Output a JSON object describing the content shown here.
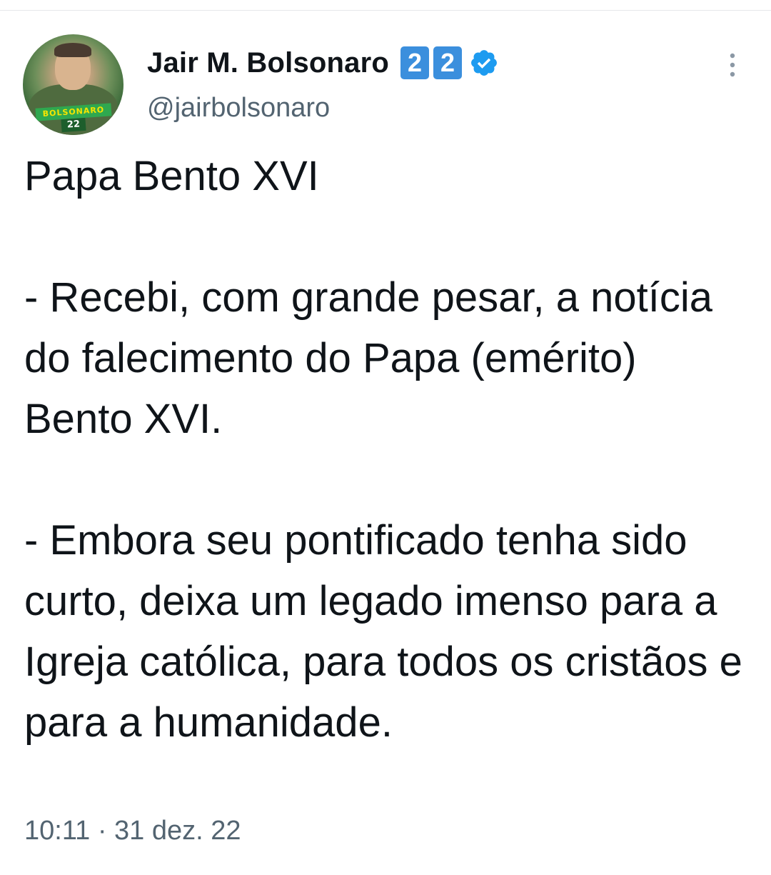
{
  "author": {
    "display_name": "Jair M. Bolsonaro",
    "handle": "@jairbolsonaro",
    "name_badges": [
      "2",
      "2"
    ],
    "avatar_banner": "BOLSONARO",
    "avatar_number": "22"
  },
  "tweet": {
    "text": "Papa Bento XVI\n\n- Recebi, com grande pesar, a notícia do falecimento do Papa (emérito) Bento XVI.\n\n- Embora seu pontificado tenha sido curto, deixa um legado imenso para a Igreja católica, para todos os cristãos e para a humanidade.",
    "timestamp": "10:11 · 31 dez. 22"
  },
  "icons": {
    "verified": "verified-badge-icon",
    "more": "more-options-icon"
  },
  "colors": {
    "verified_blue": "#1d9bf0",
    "badge_blue": "#3b8fdd",
    "secondary_text": "#536471",
    "primary_text": "#0f1419"
  }
}
